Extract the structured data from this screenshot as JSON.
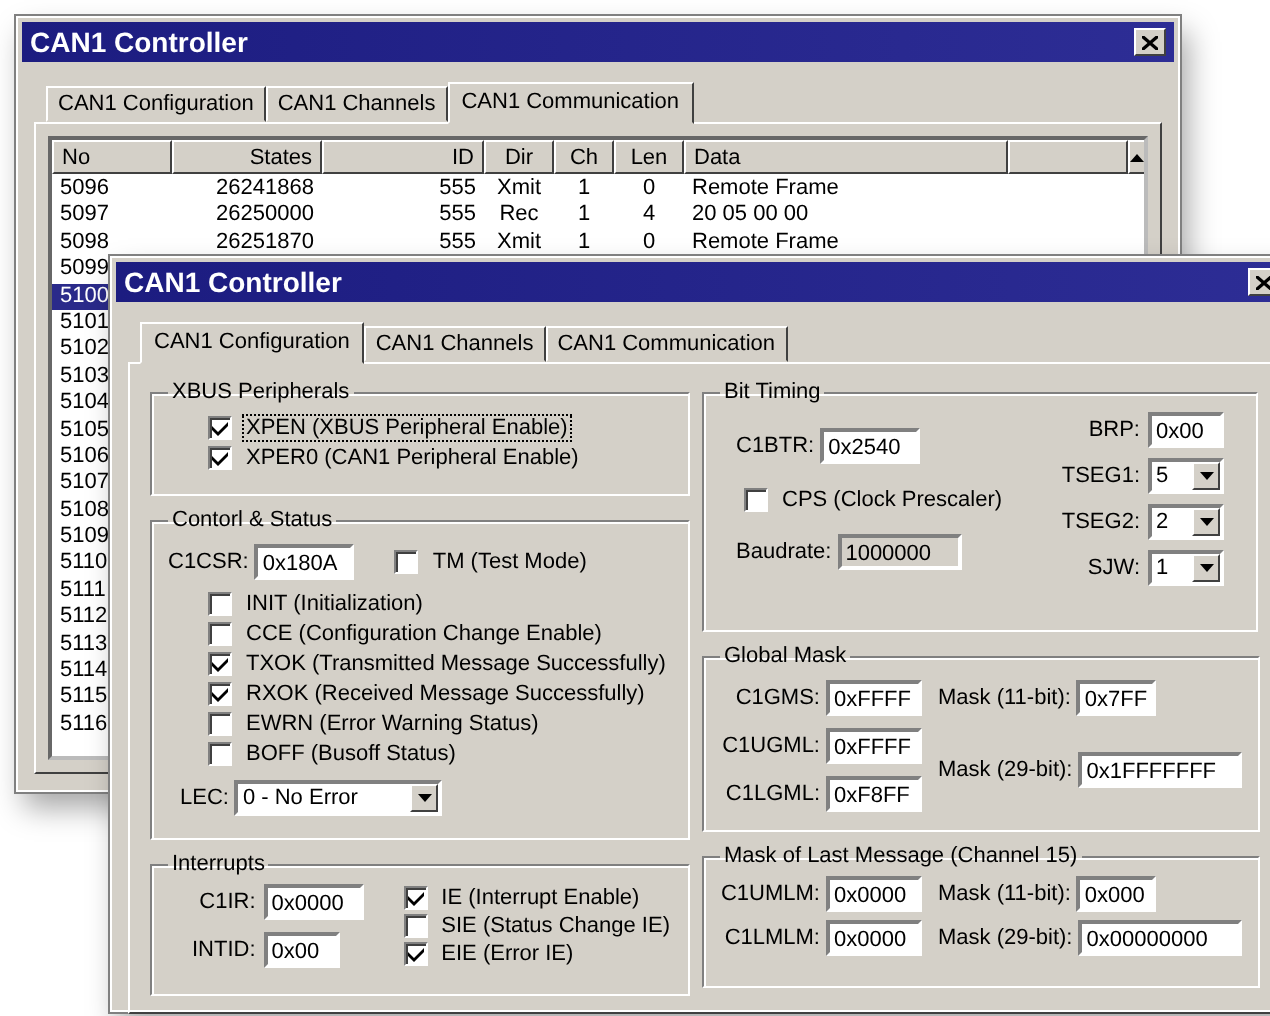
{
  "back_window": {
    "title": "CAN1 Controller",
    "tabs": [
      {
        "label": "CAN1 Configuration",
        "selected": false
      },
      {
        "label": "CAN1 Channels",
        "selected": false
      },
      {
        "label": "CAN1 Communication",
        "selected": true
      }
    ],
    "table": {
      "columns": [
        "No",
        "States",
        "ID",
        "Dir",
        "Ch",
        "Len",
        "Data"
      ],
      "rows": [
        {
          "cells": [
            "5096",
            "26241868",
            "555",
            "Xmit",
            "1",
            "0",
            "Remote Frame"
          ],
          "selected": false
        },
        {
          "cells": [
            "5097",
            "26250000",
            "555",
            "Rec",
            "1",
            "4",
            "20 05 00 00"
          ],
          "selected": false
        },
        {
          "cells": [
            "5098",
            "26251870",
            "555",
            "Xmit",
            "1",
            "0",
            "Remote Frame"
          ],
          "selected": false
        },
        {
          "cells": [
            "5099"
          ],
          "selected": false
        },
        {
          "cells": [
            "5100"
          ],
          "selected": true
        },
        {
          "cells": [
            "5101"
          ],
          "selected": false
        },
        {
          "cells": [
            "5102"
          ],
          "selected": false
        },
        {
          "cells": [
            "5103"
          ],
          "selected": false
        },
        {
          "cells": [
            "5104"
          ],
          "selected": false
        },
        {
          "cells": [
            "5105"
          ],
          "selected": false
        },
        {
          "cells": [
            "5106"
          ],
          "selected": false
        },
        {
          "cells": [
            "5107"
          ],
          "selected": false
        },
        {
          "cells": [
            "5108"
          ],
          "selected": false
        },
        {
          "cells": [
            "5109"
          ],
          "selected": false
        },
        {
          "cells": [
            "5110"
          ],
          "selected": false
        },
        {
          "cells": [
            "5111"
          ],
          "selected": false
        },
        {
          "cells": [
            "5112"
          ],
          "selected": false
        },
        {
          "cells": [
            "5113"
          ],
          "selected": false
        },
        {
          "cells": [
            "5114"
          ],
          "selected": false
        },
        {
          "cells": [
            "5115"
          ],
          "selected": false
        },
        {
          "cells": [
            "5116"
          ],
          "selected": false
        }
      ]
    }
  },
  "front_window": {
    "title": "CAN1 Controller",
    "tabs": [
      {
        "label": "CAN1 Configuration",
        "selected": true
      },
      {
        "label": "CAN1 Channels",
        "selected": false
      },
      {
        "label": "CAN1 Communication",
        "selected": false
      }
    ],
    "xbus": {
      "title": "XBUS Peripherals",
      "checkboxes": [
        {
          "label": "XPEN (XBUS Peripheral Enable)",
          "checked": true,
          "focused": true
        },
        {
          "label": "XPER0 (CAN1 Peripheral Enable)",
          "checked": true,
          "focused": false
        }
      ]
    },
    "control_status": {
      "title": "Contorl & Status",
      "field": {
        "label": "C1CSR:",
        "value": "0x180A"
      },
      "side_checkbox": {
        "label": "TM (Test Mode)",
        "checked": false
      },
      "checkboxes": [
        {
          "label": "INIT (Initialization)",
          "checked": false
        },
        {
          "label": "CCE (Configuration Change Enable)",
          "checked": false
        },
        {
          "label": "TXOK (Transmitted Message Successfully)",
          "checked": true
        },
        {
          "label": "RXOK (Received Message Successfully)",
          "checked": true
        },
        {
          "label": "EWRN (Error Warning Status)",
          "checked": false
        },
        {
          "label": "BOFF (Busoff Status)",
          "checked": false
        }
      ],
      "lec": {
        "label": "LEC:",
        "value": "0 - No Error"
      }
    },
    "interrupts": {
      "title": "Interrupts",
      "fields": [
        {
          "label": "C1IR:",
          "value": "0x0000"
        },
        {
          "label": "INTID:",
          "value": "0x00"
        }
      ],
      "checkboxes": [
        {
          "label": "IE (Interrupt Enable)",
          "checked": true
        },
        {
          "label": "SIE (Status Change IE)",
          "checked": false
        },
        {
          "label": "EIE (Error IE)",
          "checked": true
        }
      ]
    },
    "bit_timing": {
      "title": "Bit Timing",
      "c1btr": {
        "label": "C1BTR:",
        "value": "0x2540"
      },
      "cps": {
        "label": "CPS (Clock Prescaler)",
        "checked": false
      },
      "baudrate": {
        "label": "Baudrate:",
        "value": "1000000",
        "disabled": true
      },
      "params": [
        {
          "label": "BRP:",
          "value": "0x00",
          "kind": "text"
        },
        {
          "label": "TSEG1:",
          "value": "5",
          "kind": "select"
        },
        {
          "label": "TSEG2:",
          "value": "2",
          "kind": "select"
        },
        {
          "label": "SJW:",
          "value": "1",
          "kind": "select"
        }
      ]
    },
    "global_mask": {
      "title": "Global Mask",
      "registers": [
        {
          "label": "C1GMS:",
          "value": "0xFFFF"
        },
        {
          "label": "C1UGML:",
          "value": "0xFFFF"
        },
        {
          "label": "C1LGML:",
          "value": "0xF8FF"
        }
      ],
      "masks": [
        {
          "label": "Mask (11-bit):",
          "value": "0x7FF"
        },
        {
          "label": "Mask (29-bit):",
          "value": "0x1FFFFFFF"
        }
      ]
    },
    "last_message_mask": {
      "title": "Mask of Last Message (Channel 15)",
      "registers": [
        {
          "label": "C1UMLM:",
          "value": "0x0000"
        },
        {
          "label": "C1LMLM:",
          "value": "0x0000"
        }
      ],
      "masks": [
        {
          "label": "Mask (11-bit):",
          "value": "0x000"
        },
        {
          "label": "Mask (29-bit):",
          "value": "0x00000000"
        }
      ]
    }
  }
}
